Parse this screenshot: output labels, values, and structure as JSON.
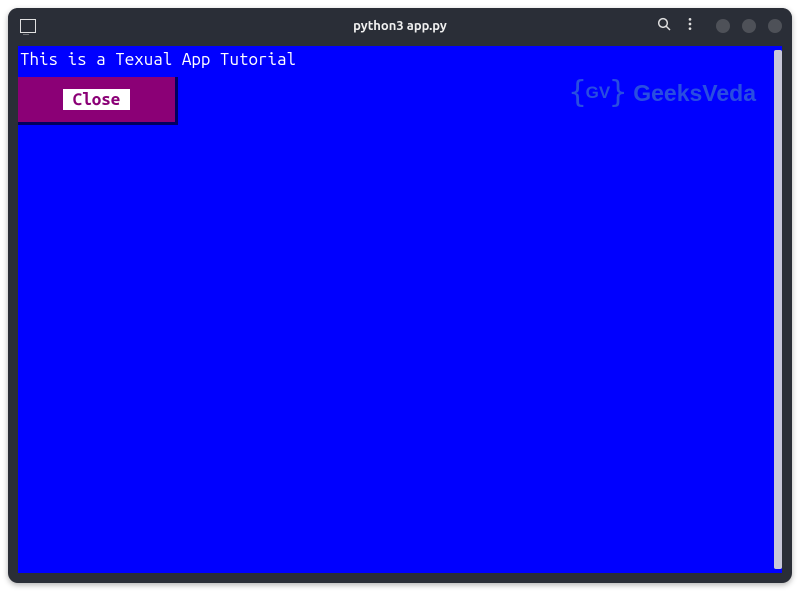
{
  "window": {
    "title": "python3 app.py"
  },
  "app": {
    "header_text": "This is a Texual App Tutorial",
    "close_button_label": "Close"
  },
  "watermark": {
    "initials": "GV",
    "text": "GeeksVeda"
  }
}
